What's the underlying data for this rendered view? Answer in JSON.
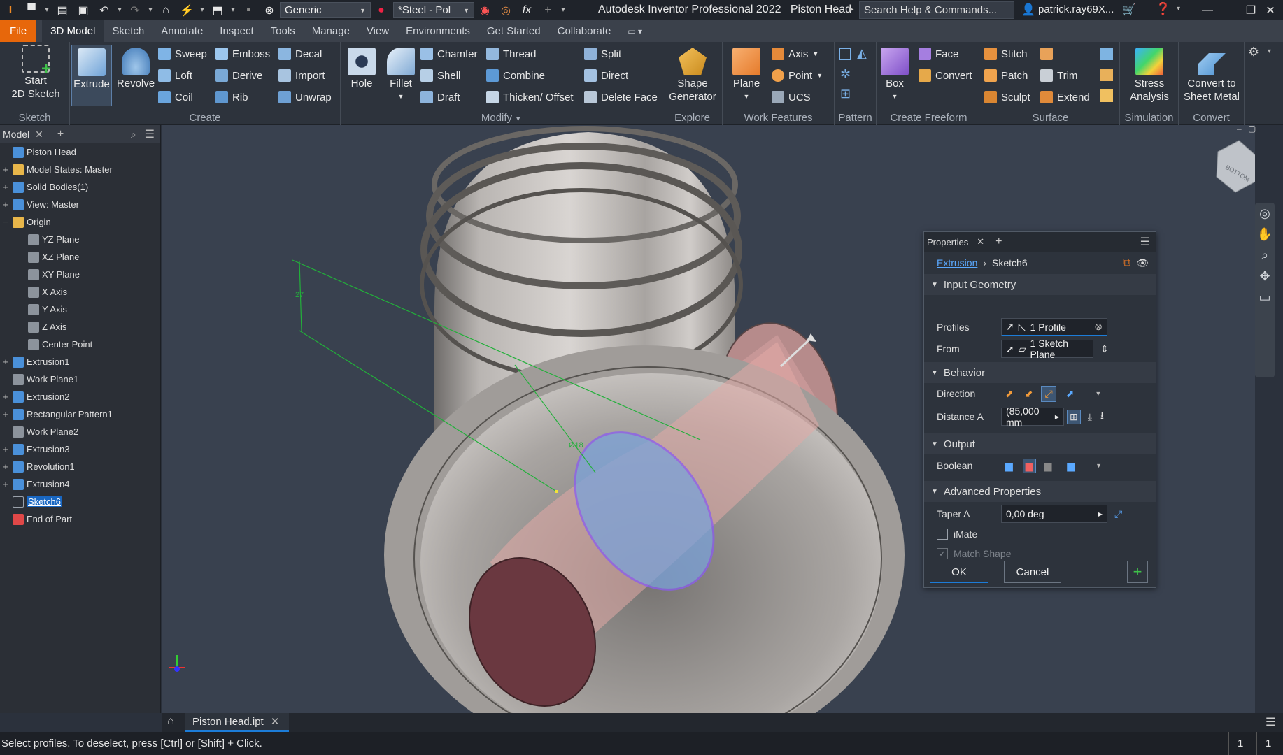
{
  "titlebar": {
    "app_title": "Autodesk Inventor Professional 2022",
    "doc_title": "Piston Head",
    "appearance_combo": "Generic",
    "material_combo": "*Steel - Pol",
    "search_placeholder": "Search Help & Commands...",
    "user": "patrick.ray69X..."
  },
  "menu": {
    "file": "File",
    "tabs": [
      "3D Model",
      "Sketch",
      "Annotate",
      "Inspect",
      "Tools",
      "Manage",
      "View",
      "Environments",
      "Get Started",
      "Collaborate"
    ]
  },
  "ribbon": {
    "sketch": {
      "label": "Sketch",
      "start": "Start",
      "start2": "2D Sketch"
    },
    "create": {
      "label": "Create",
      "extrude": "Extrude",
      "revolve": "Revolve",
      "sweep": "Sweep",
      "loft": "Loft",
      "coil": "Coil",
      "emboss": "Emboss",
      "derive": "Derive",
      "rib": "Rib",
      "decal": "Decal",
      "import": "Import",
      "unwrap": "Unwrap"
    },
    "modify": {
      "label": "Modify",
      "hole": "Hole",
      "fillet": "Fillet",
      "chamfer": "Chamfer",
      "shell": "Shell",
      "draft": "Draft",
      "thread": "Thread",
      "combine": "Combine",
      "thicken": "Thicken/ Offset",
      "split": "Split",
      "direct": "Direct",
      "delete_face": "Delete Face"
    },
    "explore": {
      "label": "Explore",
      "shape": "Shape",
      "generator": "Generator"
    },
    "work": {
      "label": "Work Features",
      "plane": "Plane",
      "axis": "Axis",
      "point": "Point",
      "ucs": "UCS"
    },
    "pattern": {
      "label": "Pattern"
    },
    "freeform": {
      "label": "Create Freeform",
      "box": "Box",
      "face": "Face",
      "convert": "Convert"
    },
    "surface": {
      "label": "Surface",
      "stitch": "Stitch",
      "patch": "Patch",
      "sculpt": "Sculpt",
      "trim": "Trim",
      "extend": "Extend"
    },
    "simulation": {
      "label": "Simulation",
      "stress": "Stress",
      "analysis": "Analysis"
    },
    "convert": {
      "label": "Convert",
      "to": "Convert to",
      "sheet": "Sheet Metal"
    }
  },
  "browser": {
    "tab": "Model",
    "items": [
      {
        "label": "Piston Head",
        "exp": "",
        "indent": 0
      },
      {
        "label": "Model States: Master",
        "exp": "+",
        "indent": 0
      },
      {
        "label": "Solid Bodies(1)",
        "exp": "+",
        "indent": 0
      },
      {
        "label": "View: Master",
        "exp": "+",
        "indent": 0
      },
      {
        "label": "Origin",
        "exp": "−",
        "indent": 0
      },
      {
        "label": "YZ Plane",
        "exp": "",
        "indent": 1
      },
      {
        "label": "XZ Plane",
        "exp": "",
        "indent": 1
      },
      {
        "label": "XY Plane",
        "exp": "",
        "indent": 1
      },
      {
        "label": "X Axis",
        "exp": "",
        "indent": 1
      },
      {
        "label": "Y Axis",
        "exp": "",
        "indent": 1
      },
      {
        "label": "Z Axis",
        "exp": "",
        "indent": 1
      },
      {
        "label": "Center Point",
        "exp": "",
        "indent": 1
      },
      {
        "label": "Extrusion1",
        "exp": "+",
        "indent": 0
      },
      {
        "label": "Work Plane1",
        "exp": "",
        "indent": 0
      },
      {
        "label": "Extrusion2",
        "exp": "+",
        "indent": 0
      },
      {
        "label": "Rectangular Pattern1",
        "exp": "+",
        "indent": 0
      },
      {
        "label": "Work Plane2",
        "exp": "",
        "indent": 0
      },
      {
        "label": "Extrusion3",
        "exp": "+",
        "indent": 0
      },
      {
        "label": "Revolution1",
        "exp": "+",
        "indent": 0
      },
      {
        "label": "Extrusion4",
        "exp": "+",
        "indent": 0
      },
      {
        "label": "Sketch6",
        "exp": "",
        "indent": 0,
        "selected": true
      },
      {
        "label": "End of Part",
        "exp": "",
        "indent": 0
      }
    ]
  },
  "viewport": {
    "dim1": "27",
    "dim2": "Ø18",
    "viewcube": "BOTTOM"
  },
  "props": {
    "tab": "Properties",
    "crumb_feature": "Extrusion",
    "crumb_sketch": "Sketch6",
    "sec_input": "Input Geometry",
    "profiles_label": "Profiles",
    "profiles_value": "1 Profile",
    "from_label": "From",
    "from_value": "1 Sketch Plane",
    "sec_behavior": "Behavior",
    "direction_label": "Direction",
    "distance_label": "Distance A",
    "distance_value": "(85,000 mm",
    "sec_output": "Output",
    "boolean_label": "Boolean",
    "sec_adv": "Advanced Properties",
    "taper_label": "Taper A",
    "taper_value": "0,00 deg",
    "imate": "iMate",
    "match_shape": "Match Shape",
    "ok": "OK",
    "cancel": "Cancel"
  },
  "doctab": "Piston Head.ipt",
  "status": {
    "text": "Select profiles. To deselect, press [Ctrl] or [Shift] + Click.",
    "n1": "1",
    "n2": "1"
  }
}
